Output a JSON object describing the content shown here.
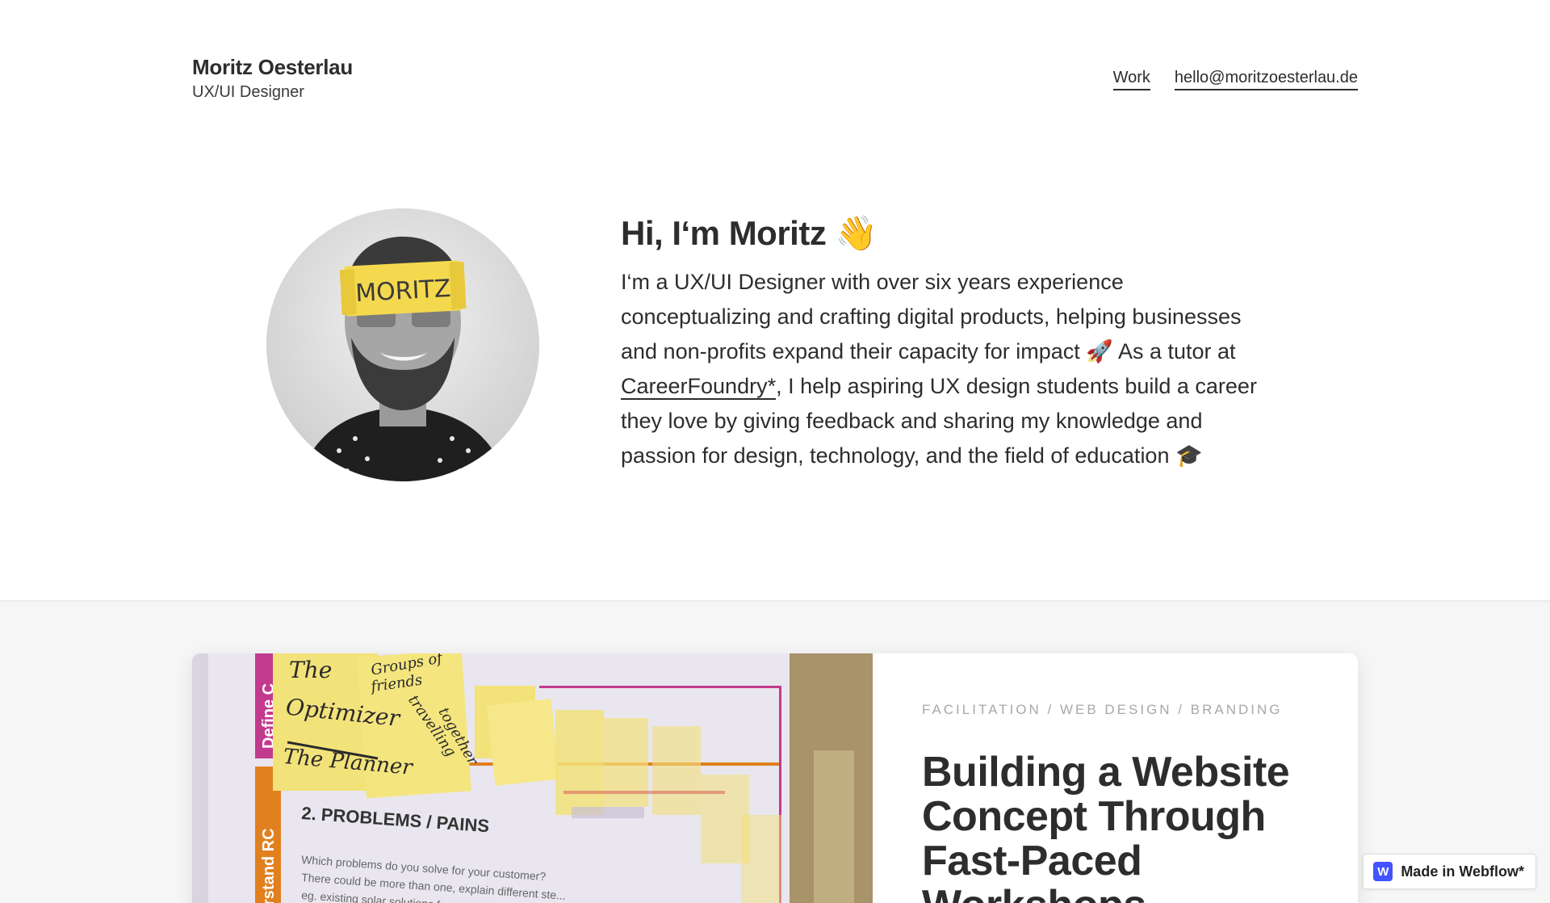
{
  "header": {
    "name": "Moritz Oesterlau",
    "role": "UX/UI Designer",
    "nav": {
      "work": "Work",
      "email": "hello@moritzoesterlau.de"
    }
  },
  "hero": {
    "avatar_note": "MORITZ",
    "title": "Hi, I‘m Moritz 👋",
    "text_before_link": "I‘m a UX/UI Designer with over six years experience conceptualizing and crafting digital products, helping businesses and non-profits expand their capacity for impact 🚀 As a tutor at ",
    "link": "CareerFoundry*",
    "text_after_link": ", I help aspiring UX design students build a career they love by giving feedback and sharing my knowledge and passion for design, technology, and the field of education 🎓"
  },
  "work": {
    "card": {
      "tags": "Facilitation / Web Design / Branding",
      "title": "Building a Website Concept Through Fast-Paced Workshops",
      "image_texts": {
        "sidebar_top": "Define C",
        "sidebar_bottom": "rstand RC",
        "note1_line1": "The",
        "note1_line2": "Optimizer",
        "note1_line3": "The Planner",
        "note2_line1": "Groups of",
        "note2_line2": "friends",
        "note2_line3": "travelling",
        "note2_line4": "together",
        "heading": "2. PROBLEMS / PAINS",
        "line1": "Which problems do you solve for your customer?",
        "line2": "There could be more than one, explain different ste...",
        "line3": "eg. existing solar solutions for ..."
      }
    }
  },
  "badge": {
    "logo": "W",
    "label": "Made in Webflow*"
  },
  "colors": {
    "text": "#2d2d2d",
    "section_bg": "#f6f6f6",
    "webflow_blue": "#4353ff"
  }
}
